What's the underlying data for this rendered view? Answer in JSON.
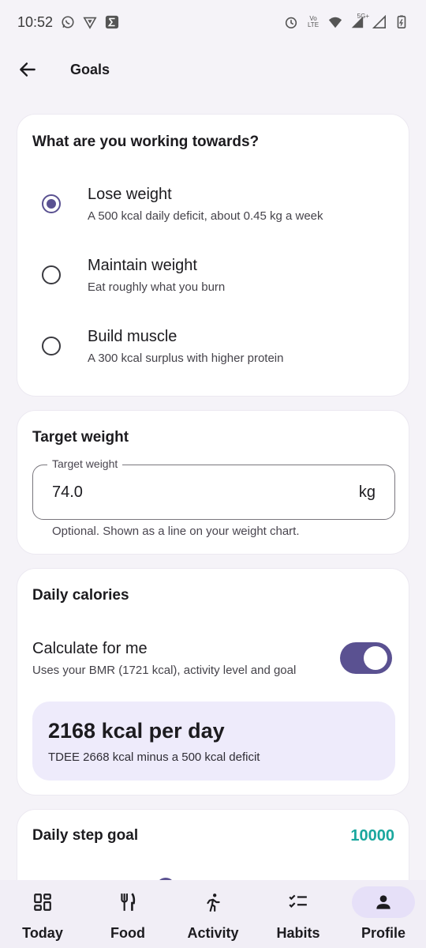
{
  "status_bar": {
    "time": "10:52",
    "network_small_1": "Vo",
    "network_small_2": "LTE",
    "network_5g": "5G+"
  },
  "appbar": {
    "title": "Goals"
  },
  "goal_card": {
    "title": "What are you working towards?",
    "options": [
      {
        "label": "Lose weight",
        "sub": "A 500 kcal daily deficit, about 0.45 kg a week",
        "selected": true
      },
      {
        "label": "Maintain weight",
        "sub": "Eat roughly what you burn",
        "selected": false
      },
      {
        "label": "Build muscle",
        "sub": "A 300 kcal surplus with higher protein",
        "selected": false
      }
    ]
  },
  "target_card": {
    "title": "Target weight",
    "field_label": "Target weight",
    "field_value": "74.0",
    "field_suffix": "kg",
    "helper": "Optional. Shown as a line on your weight chart."
  },
  "calories_card": {
    "title": "Daily calories",
    "toggle_label": "Calculate for me",
    "toggle_sub": "Uses your BMR (1721 kcal), activity level and goal",
    "toggle_on": true,
    "result_big": "2168 kcal per day",
    "result_sub": "TDEE 2668 kcal minus a 500 kcal deficit"
  },
  "steps_card": {
    "title": "Daily step goal",
    "value": "10000"
  },
  "bottom_nav": {
    "items": [
      {
        "label": "Today",
        "icon": "dashboard-icon"
      },
      {
        "label": "Food",
        "icon": "restaurant-icon"
      },
      {
        "label": "Activity",
        "icon": "run-icon"
      },
      {
        "label": "Habits",
        "icon": "checklist-icon"
      },
      {
        "label": "Profile",
        "icon": "person-icon",
        "active": true
      }
    ]
  },
  "colors": {
    "accent": "#5a5191",
    "step_value": "#1aa79e",
    "highlight_box": "#eeebfb"
  }
}
